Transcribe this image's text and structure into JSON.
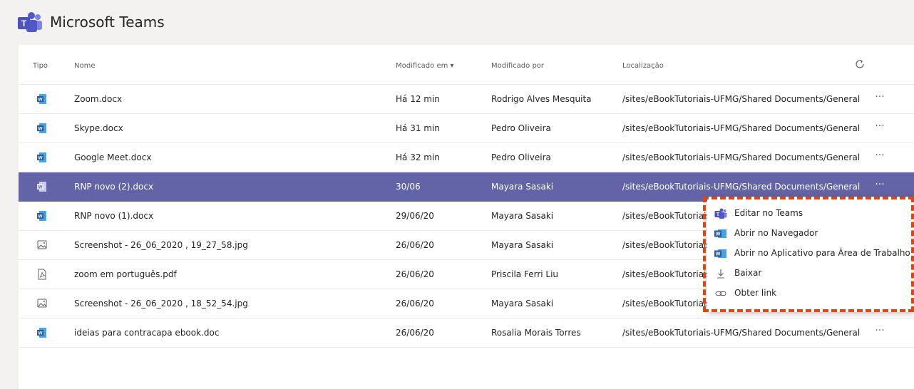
{
  "app": {
    "title": "Microsoft Teams"
  },
  "columns": {
    "type": "Tipo",
    "name": "Nome",
    "modified": "Modificado em ▾",
    "modified_by": "Modificado por",
    "location": "Localização"
  },
  "colors": {
    "accent": "#6264a7",
    "word_blue": "#2b579a",
    "dashed_highlight": "#d9480f"
  },
  "files": [
    {
      "icon": "word-file-icon",
      "name": "Zoom.docx",
      "modified": "Há 12 min",
      "modified_by": "Rodrigo Alves Mesquita",
      "location": "/sites/eBookTutoriais-UFMG/Shared Documents/General",
      "more": "···"
    },
    {
      "icon": "word-file-icon",
      "name": "Skype.docx",
      "modified": "Há 31 min",
      "modified_by": "Pedro Oliveira",
      "location": "/sites/eBookTutoriais-UFMG/Shared Documents/General",
      "more": "···"
    },
    {
      "icon": "word-file-icon",
      "name": "Google Meet.docx",
      "modified": "Há 32 min",
      "modified_by": "Pedro Oliveira",
      "location": "/sites/eBookTutoriais-UFMG/Shared Documents/General",
      "more": "···"
    },
    {
      "icon": "word-file-icon",
      "name": "RNP novo (2).docx",
      "modified": "30/06",
      "modified_by": "Mayara Sasaki",
      "location": "/sites/eBookTutoriais-UFMG/Shared Documents/General",
      "more": "···"
    },
    {
      "icon": "word-file-icon",
      "name": "RNP novo (1).docx",
      "modified": "29/06/20",
      "modified_by": "Mayara Sasaki",
      "location": "/sites/eBookTutoriais",
      "more": ""
    },
    {
      "icon": "image-file-icon",
      "name": "Screenshot - 26_06_2020 , 19_27_58.jpg",
      "modified": "26/06/20",
      "modified_by": "Mayara Sasaki",
      "location": "/sites/eBookTutoriais",
      "more": ""
    },
    {
      "icon": "pdf-file-icon",
      "name": "zoom em português.pdf",
      "modified": "26/06/20",
      "modified_by": "Priscila Ferri Liu",
      "location": "/sites/eBookTutoriais",
      "more": ""
    },
    {
      "icon": "image-file-icon",
      "name": "Screenshot - 26_06_2020 , 18_52_54.jpg",
      "modified": "26/06/20",
      "modified_by": "Mayara Sasaki",
      "location": "/sites/eBookTutoriais",
      "more": ""
    },
    {
      "icon": "word-file-icon",
      "name": "ideias para contracapa ebook.doc",
      "modified": "26/06/20",
      "modified_by": "Rosalia Morais Torres",
      "location": "/sites/eBookTutoriais-UFMG/Shared Documents/General",
      "more": "···"
    }
  ],
  "context_menu": {
    "items": [
      {
        "icon": "teams-icon",
        "label": "Editar no Teams"
      },
      {
        "icon": "word-app-icon",
        "label": "Abrir no Navegador"
      },
      {
        "icon": "word-app-icon",
        "label": "Abrir no Aplicativo para Área de Trabalho"
      },
      {
        "icon": "download-icon",
        "label": "Baixar"
      },
      {
        "icon": "link-icon",
        "label": "Obter link"
      }
    ]
  }
}
